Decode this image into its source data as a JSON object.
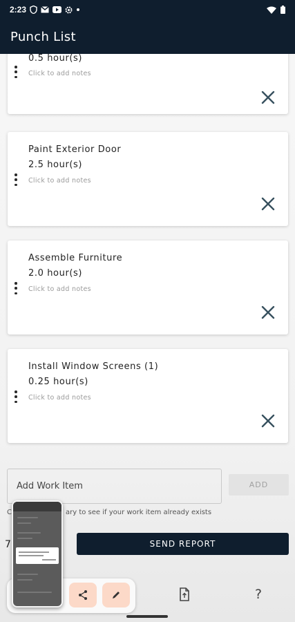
{
  "status_bar": {
    "time": "2:23",
    "icons": [
      "shield-icon",
      "gmail-icon",
      "youtube-icon",
      "settings-icon",
      "dot-icon"
    ],
    "right_icons": [
      "wifi-icon",
      "battery-icon"
    ]
  },
  "app_bar": {
    "title": "Punch List"
  },
  "work_items": [
    {
      "title": "",
      "hours": "0.5 hour(s)",
      "notes": "Click to add notes"
    },
    {
      "title": "Paint Exterior Door",
      "hours": "2.5 hour(s)",
      "notes": "Click to add notes"
    },
    {
      "title": "Assemble Furniture",
      "hours": "2.0 hour(s)",
      "notes": "Click to add notes"
    },
    {
      "title": "Install Window Screens (1)",
      "hours": "0.25 hour(s)",
      "notes": "Click to add notes"
    }
  ],
  "add_form": {
    "placeholder": "Add Work Item",
    "button_label": "ADD",
    "helper_start": "C",
    "helper_end": "ary to see if your work item already exists"
  },
  "total_label": "7",
  "send_button": "SEND REPORT",
  "bottom_nav": {
    "icons": [
      "document-icon",
      "help-icon"
    ],
    "help_glyph": "?"
  },
  "screenshot_preview": {
    "actions": [
      "share-icon",
      "edit-icon"
    ]
  },
  "colors": {
    "navy": "#0f1e2e",
    "accent_peach": "#fcd9c8",
    "close_icon": "#37505e"
  }
}
